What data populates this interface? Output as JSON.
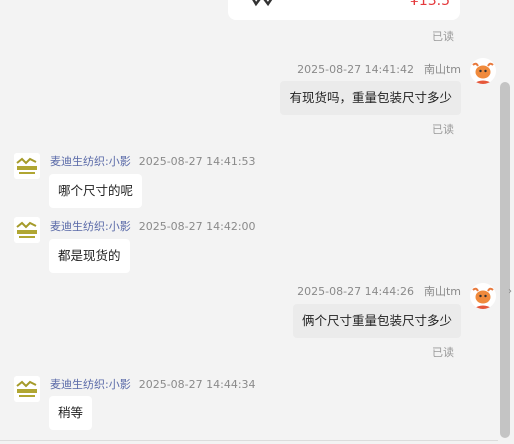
{
  "product": {
    "price": "¥13.5",
    "read": "已读"
  },
  "messages": [
    {
      "side": "right",
      "time": "2025-08-27 14:41:42",
      "name": "南山tm",
      "text": "有现货吗，重量包装尺寸多少",
      "read": "已读"
    },
    {
      "side": "left",
      "name": "麦迪生纺织:小影",
      "time": "2025-08-27 14:41:53",
      "text": "哪个尺寸的呢"
    },
    {
      "side": "left",
      "name": "麦迪生纺织:小影",
      "time": "2025-08-27 14:42:00",
      "text": "都是现货的"
    },
    {
      "side": "right",
      "time": "2025-08-27 14:44:26",
      "name": "南山tm",
      "text": "俩个尺寸重量包装尺寸多少",
      "read": "已读"
    },
    {
      "side": "left",
      "name": "麦迪生纺织:小影",
      "time": "2025-08-27 14:44:34",
      "text": "稍等"
    }
  ],
  "icons": {
    "user_avatar": "cartoon-bull-avatar-icon",
    "shop_avatar": "shop-logo-icon",
    "edge": "chevron-right-icon"
  },
  "colors": {
    "price": "#e4393c",
    "shop_name": "#5a6aa8",
    "background": "#f3f3f3"
  }
}
